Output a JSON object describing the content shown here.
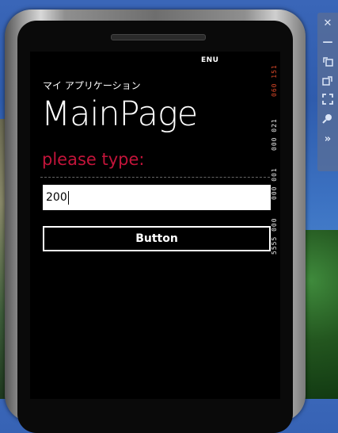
{
  "status_bar": {
    "language": "ENU"
  },
  "app": {
    "title": "マイ アプリケーション",
    "page_title": "MainPage",
    "prompt": "please type:",
    "prompt_color": "#c2143a"
  },
  "input": {
    "value": "200"
  },
  "button": {
    "label": "Button"
  },
  "frame_counters": [
    "060 151",
    "000 021",
    "000 001",
    "5555 000"
  ],
  "toolbar": {
    "icons": [
      "close-icon",
      "minimize-icon",
      "rotate-left-icon",
      "rotate-right-icon",
      "fit-to-screen-icon",
      "zoom-icon",
      "more-icon"
    ]
  }
}
